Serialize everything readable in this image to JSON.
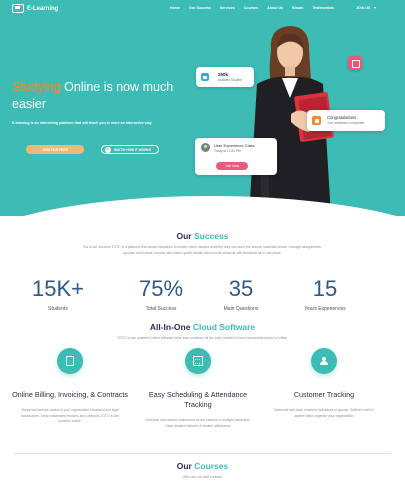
{
  "nav": {
    "brand": "E-Learning",
    "links": [
      "Home",
      "Our Success",
      "Services",
      "Courses",
      "About Us",
      "Blouts",
      "Testimonials"
    ],
    "join": "JOIN US"
  },
  "hero": {
    "title_highlight": "Studying",
    "title_rest": " Online is now much easier",
    "description": "E-learning is an interesting platform that will teach you in more an interactive way",
    "btn_free": "JOIN FOR FREE",
    "btn_watch": "WATCH HOW IT WORKS",
    "students_count": "250k",
    "students_label": "Assisted Student",
    "congrats_title": "Congratulations",
    "congrats_sub": "Your admission completed",
    "class_title": "User Experience Class",
    "class_sub": "Today at 12.00 PM",
    "class_btn": "Join Now"
  },
  "success": {
    "title_plain": "Our ",
    "title_accent": "Success",
    "description": "Ets is our success TOTC is a platform that allows educators to create online classes whereby they can store the course materials online; manage assignments, quizzes and exams; monitor due dates; grade results and provide students with feedback all in one place.",
    "stats": [
      {
        "value": "15K+",
        "label": "Students"
      },
      {
        "value": "75%",
        "label": "Total Success"
      },
      {
        "value": "35",
        "label": "Main Questions"
      },
      {
        "value": "15",
        "label": "Years Experiences"
      }
    ]
  },
  "software": {
    "title_plain": "All-In-One ",
    "title_accent": "Cloud Software",
    "description": "TOTC is one powerful online software suite that combines all the tools needed to run a successful school or office.",
    "features": [
      {
        "icon": "document-icon",
        "title": "Online Billing, Invoicing, & Contracts",
        "desc": "Simple and secure control of your organization's financial and legal transactions. Send customized invoices and contracts TOTC is one powerful online."
      },
      {
        "icon": "calendar-icon",
        "title": "Easy Scheduling & Attendance Tracking",
        "desc": "Schedule and reserve classrooms at one campus or multiple campuses. Keep detailed records of student attendance"
      },
      {
        "icon": "users-icon",
        "title": "Customer Tracking",
        "desc": "Automate and track emails to individuals or groups. Skilline's built-in system helps organize your organization"
      }
    ]
  },
  "courses": {
    "title_plain": "Our ",
    "title_accent": "Courses",
    "subtitle": "Who are our best courses"
  },
  "colors": {
    "teal": "#3dbcb6",
    "orange": "#f48a26",
    "navy": "#2d5a86",
    "pink": "#e85a7e"
  }
}
